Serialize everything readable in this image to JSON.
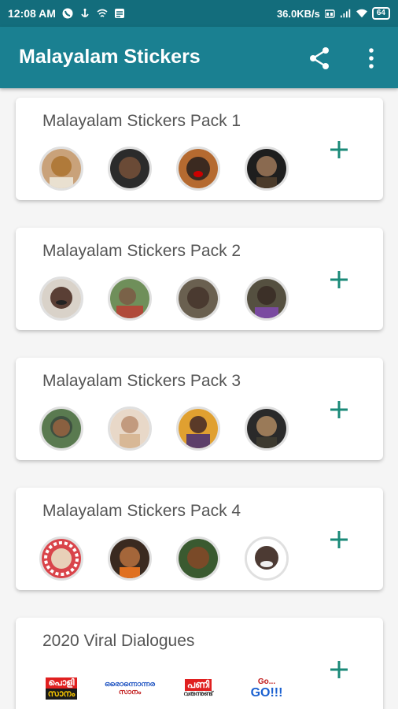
{
  "status": {
    "time": "12:08 AM",
    "speed": "36.0KB/s",
    "battery": "64"
  },
  "appbar": {
    "title": "Malayalam Stickers"
  },
  "packs": [
    {
      "name": "Malayalam Stickers Pack 1",
      "colors": [
        "#b07a3a",
        "#6a4a36",
        "#3b2a20",
        "#4a3a2a"
      ]
    },
    {
      "name": "Malayalam Stickers Pack 2",
      "colors": [
        "#5a3f35",
        "#7a6248",
        "#4a3a30",
        "#3c3028"
      ]
    },
    {
      "name": "Malayalam Stickers Pack 3",
      "colors": [
        "#3e5040",
        "#c29a7e",
        "#5d3f6a",
        "#3d3a30"
      ]
    },
    {
      "name": "Malayalam Stickers Pack 4",
      "colors": [
        "#d9444a",
        "#a4663a",
        "#7a4a28",
        "#4c3a33"
      ]
    },
    {
      "name": "2020 Viral Dialogues",
      "colors": [
        "#f0c000",
        "#ffffff",
        "#ffffff",
        "#ffffff"
      ]
    }
  ],
  "viral_stickers": [
    {
      "line1": "പൊളി",
      "line2": "സാനം"
    },
    {
      "line1": "ഒരൊന്നൊന്നര",
      "line2": "സാനം"
    },
    {
      "line1": "പണി",
      "line2": "വരുന്നുണ്ട്"
    },
    {
      "line1": "Go...",
      "line2": "GO!!!"
    }
  ],
  "icons": {
    "share": "share-icon",
    "more": "more-vert-icon",
    "add": "plus-icon"
  },
  "accent": "#1a8091",
  "plus_color": "#1a8a78"
}
